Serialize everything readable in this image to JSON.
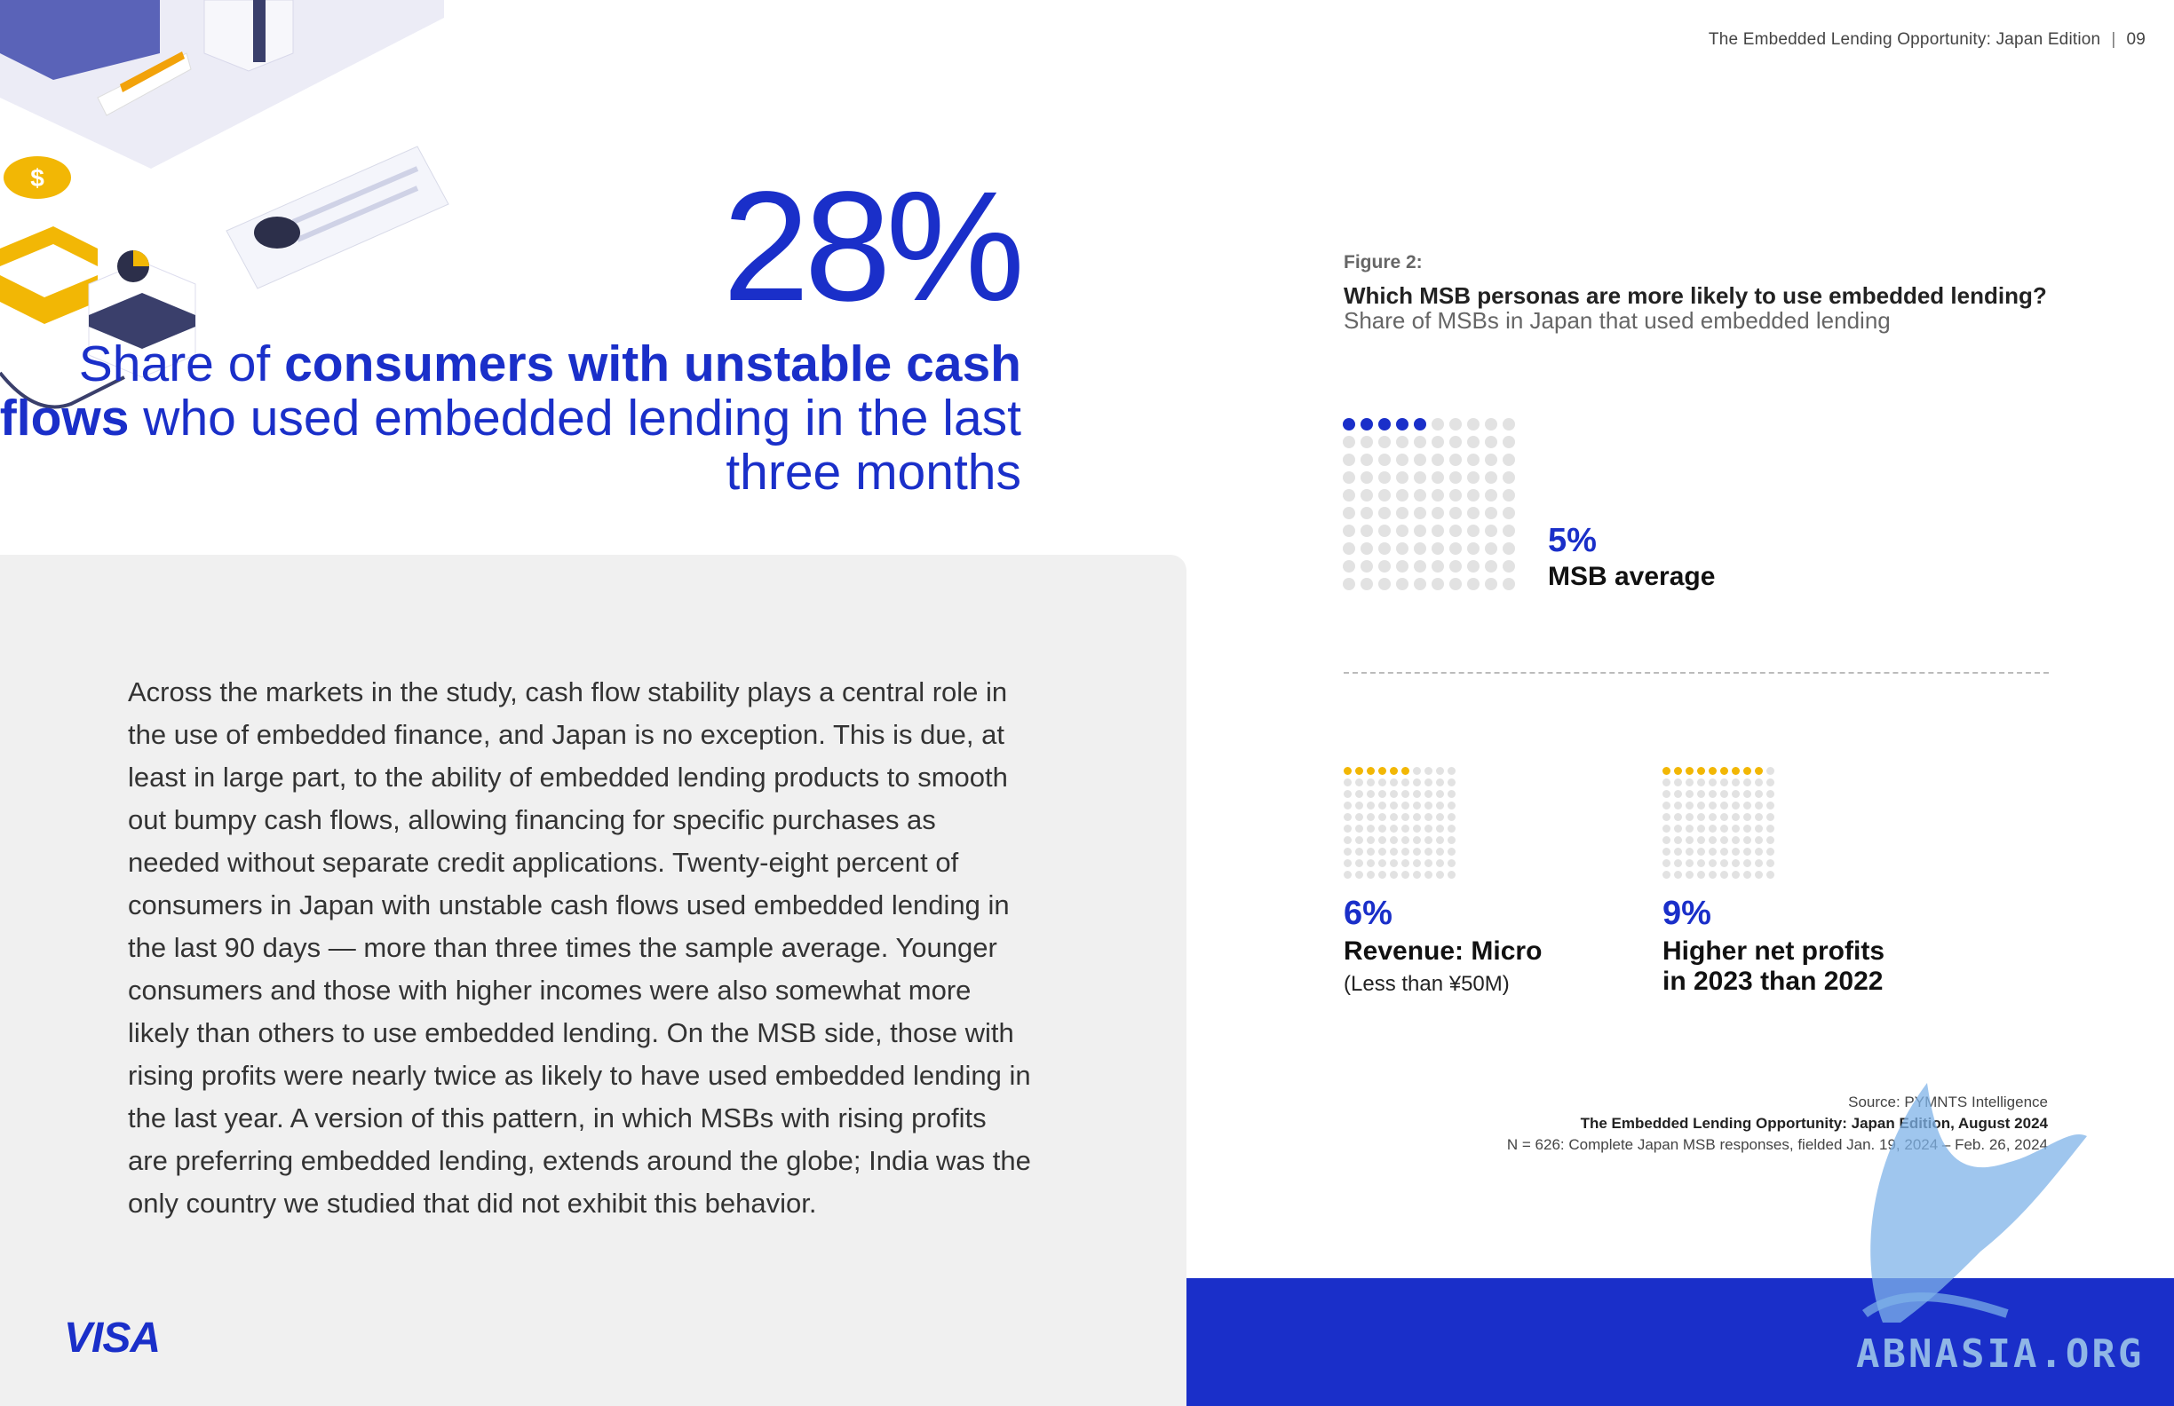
{
  "header": {
    "running_title": "The Embedded Lending Opportunity: Japan Edition",
    "separator": "|",
    "page_number": "09"
  },
  "hero": {
    "stat": "28%",
    "caption_part1": "Share of ",
    "caption_bold": "consumers with unstable cash flows",
    "caption_part2": " who used embedded lending in the last three months"
  },
  "body": {
    "paragraph": "Across the markets in the study, cash flow stability plays a central role in the use of embedded finance, and Japan is no exception. This is due, at least in large part, to the ability of embedded lending products to smooth out bumpy cash flows, allowing financing for specific purchases as needed without separate credit applications. Twenty-eight percent of consumers in Japan with unstable cash flows used embedded lending in the last 90 days — more than three times the sample average. Younger consumers and those with higher incomes were also somewhat more likely than others to use embedded lending. On the MSB side, those with rising profits were nearly twice as likely to have used embedded lending in the last year. A version of this pattern, in which MSBs with rising profits are preferring embedded lending, extends around the globe; India was the only country we studied that did not exhibit this behavior."
  },
  "brand": {
    "logo": "VISA"
  },
  "figure": {
    "label": "Figure 2:",
    "title": "Which MSB personas are more likely to use embedded lending?",
    "subtitle": "Share of MSBs in Japan that used embedded lending",
    "stats": [
      {
        "pct": "5%",
        "label": "MSB average",
        "note": "",
        "value": 5,
        "color": "#1a2fc9"
      },
      {
        "pct": "6%",
        "label": "Revenue: Micro",
        "note": "(Less than ¥50M)",
        "value": 6,
        "color": "#f2b705"
      },
      {
        "pct": "9%",
        "label": "Higher net profits in 2023 than 2022",
        "note": "",
        "value": 9,
        "color": "#f2b705"
      }
    ]
  },
  "source": {
    "line1": "Source: PYMNTS Intelligence",
    "line2": "The Embedded Lending Opportunity: Japan Edition, August 2024",
    "line3": "N = 626: Complete Japan MSB responses, fielded Jan. 19, 2024 – Feb. 26, 2024"
  },
  "watermark": {
    "text": "ABNASIA.ORG"
  },
  "colors": {
    "brand_blue": "#1a2fc9",
    "gold": "#f2b705",
    "panel_grey": "#f0f0f0",
    "dot_grey": "#e2e2e2"
  }
}
